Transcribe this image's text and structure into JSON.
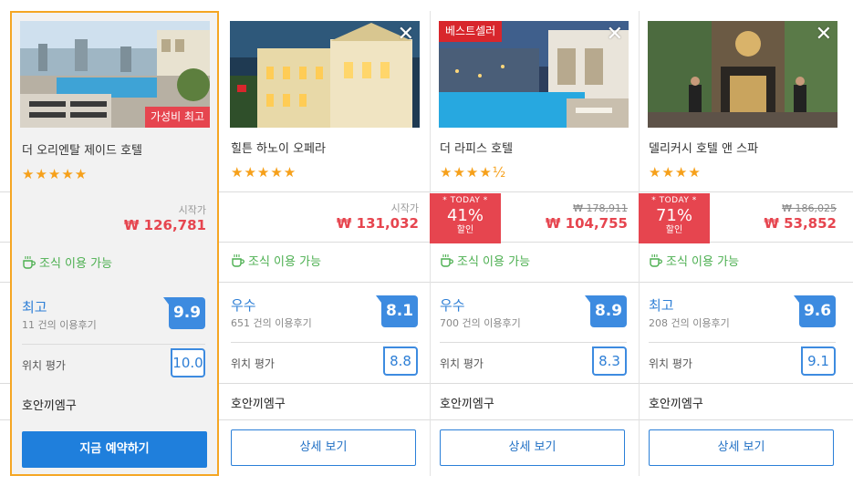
{
  "hotels": [
    {
      "name": "더 오리엔탈 제이드 호텔",
      "stars": "★★★★★",
      "ribbon": "가성비 최고",
      "price_label": "시작가",
      "price": "₩ 126,781",
      "breakfast": "조식 이용 가능",
      "rating_label": "최고",
      "review_count": "11 건의 이용후기",
      "score": "9.9",
      "location_label": "위치 평가",
      "location_score": "10.0",
      "district": "호안끼엠구",
      "button": "지금 예약하기"
    },
    {
      "name": "힐튼 하노이 오페라",
      "stars": "★★★★★",
      "close": "✕",
      "price_label": "시작가",
      "price": "₩ 131,032",
      "breakfast": "조식 이용 가능",
      "rating_label": "우수",
      "review_count": "651 건의 이용후기",
      "score": "8.1",
      "location_label": "위치 평가",
      "location_score": "8.8",
      "district": "호안끼엠구",
      "button": "상세 보기"
    },
    {
      "name": "더 라피스 호텔",
      "stars": "★★★★½",
      "close": "✕",
      "ribbon": "베스트셀러",
      "deal_today": "* TODAY *",
      "deal_pct": "41%",
      "deal_off": "할인",
      "old_price": "₩ 178,911",
      "price": "₩ 104,755",
      "breakfast": "조식 이용 가능",
      "rating_label": "우수",
      "review_count": "700 건의 이용후기",
      "score": "8.9",
      "location_label": "위치 평가",
      "location_score": "8.3",
      "district": "호안끼엠구",
      "button": "상세 보기"
    },
    {
      "name": "델리커시 호텔 앤 스파",
      "stars": "★★★★",
      "close": "✕",
      "deal_today": "* TODAY *",
      "deal_pct": "71%",
      "deal_off": "할인",
      "old_price": "₩ 186,025",
      "price": "₩ 53,852",
      "breakfast": "조식 이용 가능",
      "rating_label": "최고",
      "review_count": "208 건의 이용후기",
      "score": "9.6",
      "location_label": "위치 평가",
      "location_score": "9.1",
      "district": "호안끼엠구",
      "button": "상세 보기"
    }
  ],
  "colors": {
    "accent_blue": "#1f7fdc",
    "price_red": "#e6454f",
    "star_orange": "#f6a01a",
    "breakfast_green": "#4caf50",
    "featured_border": "#f5a623"
  }
}
